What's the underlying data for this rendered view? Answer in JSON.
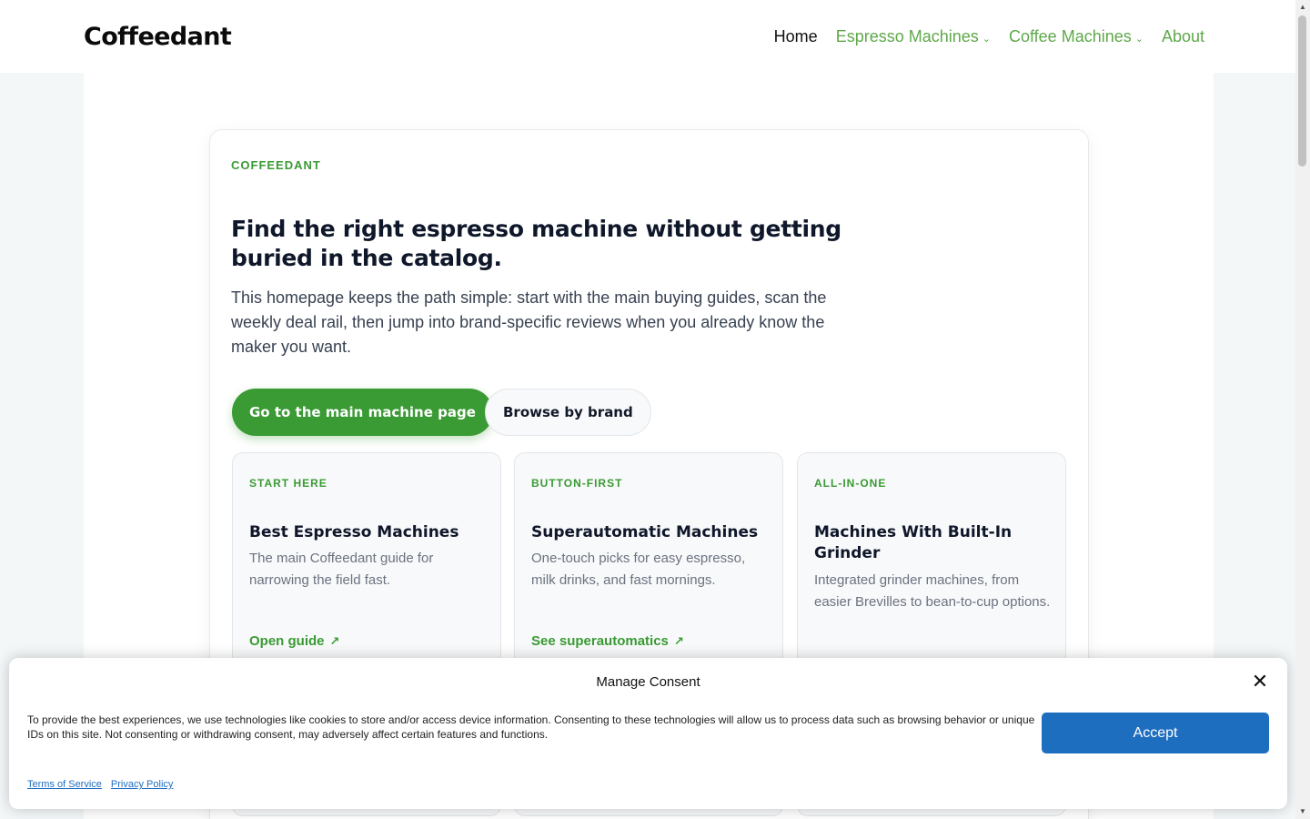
{
  "header": {
    "logo": "Coffeedant",
    "nav": [
      {
        "label": "Home",
        "active": true,
        "dropdown": false
      },
      {
        "label": "Espresso Machines",
        "active": false,
        "dropdown": true
      },
      {
        "label": "Coffee Machines",
        "active": false,
        "dropdown": true
      },
      {
        "label": "About",
        "active": false,
        "dropdown": false
      }
    ]
  },
  "hero": {
    "eyebrow": "COFFEEDANT",
    "title": "Find the right espresso machine without getting buried in the catalog.",
    "description": "This homepage keeps the path simple: start with the main buying guides, scan the weekly deal rail, then jump into brand-specific reviews when you already know the maker you want.",
    "primary_cta": "Go to the main machine page",
    "secondary_cta": "Browse by brand"
  },
  "guides": [
    {
      "eyebrow": "START HERE",
      "title": "Best Espresso Machines",
      "description": "The main Coffeedant guide for narrowing the field fast.",
      "link": "Open guide"
    },
    {
      "eyebrow": "BUTTON-FIRST",
      "title": "Superautomatic Machines",
      "description": "One-touch picks for easy espresso, milk drinks, and fast mornings.",
      "link": "See superautomatics"
    },
    {
      "eyebrow": "ALL-IN-ONE",
      "title": "Machines With Built-In Grinder",
      "description": "Integrated grinder machines, from easier Brevilles to bean-to-cup options.",
      "link": ""
    }
  ],
  "consent": {
    "title": "Manage Consent",
    "text": "To provide the best experiences, we use technologies like cookies to store and/or access device information. Consenting to these technologies will allow us to process data such as browsing behavior or unique IDs on this site. Not consenting or withdrawing consent, may adversely affect certain features and functions.",
    "accept": "Accept",
    "links": [
      "Terms of Service",
      "Privacy Policy"
    ]
  },
  "colors": {
    "accent": "#3a9a34",
    "nav_link": "#5fa84a",
    "consent_button": "#1e6ec0"
  }
}
